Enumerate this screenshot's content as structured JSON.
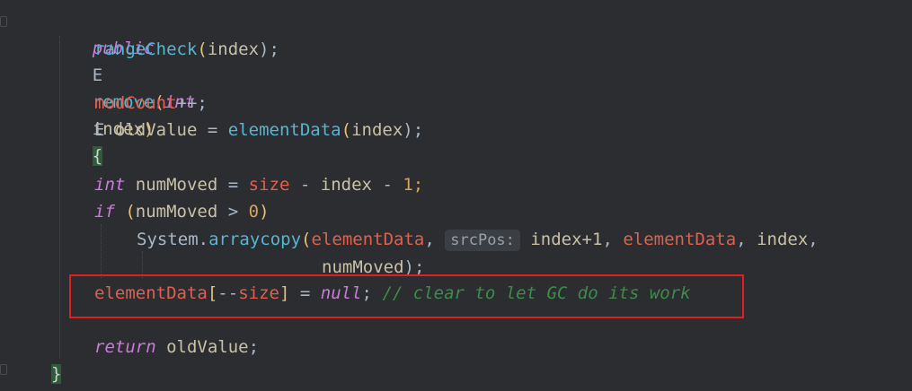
{
  "code": {
    "line1": {
      "kw_public": "public",
      "type_e": "E",
      "name": "remove",
      "paren_open": "(",
      "kw_int": "int",
      "param": "index",
      "paren_close": ")",
      "brace_open": "{"
    },
    "line2": {
      "call": "rangeCheck",
      "open": "(",
      "arg": "index",
      "close": ");"
    },
    "line3": {
      "field": "modCount",
      "op": "++;"
    },
    "line4": {
      "type": "E",
      "var": "oldValue",
      "eq": "=",
      "call": "elementData",
      "open": "(",
      "arg": "index",
      "close": ");"
    },
    "line5": {
      "kw_int": "int",
      "var": "numMoved",
      "eq": "=",
      "field": "size",
      "minus1": "-",
      "ident": "index",
      "minus2": "-",
      "num": "1;"
    },
    "line6": {
      "kw_if": "if",
      "open": "(",
      "var": "numMoved",
      "gt": ">",
      "num": "0",
      "close": ")"
    },
    "line7": {
      "cls": "System",
      "dot": ".",
      "call": "arraycopy",
      "open": "(",
      "arg1": "elementData",
      "comma1": ",",
      "hint": "srcPos:",
      "arg2": "index+1",
      "comma2": ",",
      "arg3": "elementData",
      "comma3": ",",
      "arg4": "index",
      "comma4": ","
    },
    "line8": {
      "arg": "numMoved",
      "close": ");"
    },
    "line9": {
      "field": "elementData",
      "bopen": "[",
      "decr": "--",
      "size": "size",
      "bclose": "]",
      "eq": "=",
      "kw_null": "null",
      "semi": ";",
      "comment": "// clear to let GC do its work"
    },
    "line10": {
      "kw_return": "return",
      "var": "oldValue",
      "semi": ";"
    },
    "line11": {
      "brace_close": "}"
    }
  },
  "colors": {
    "background": "#2b2d30",
    "keyword": "#c97cd8",
    "function": "#56b6d2",
    "field": "#e0604d",
    "comment": "#3f8c4a",
    "highlight_box": "#e02020"
  }
}
